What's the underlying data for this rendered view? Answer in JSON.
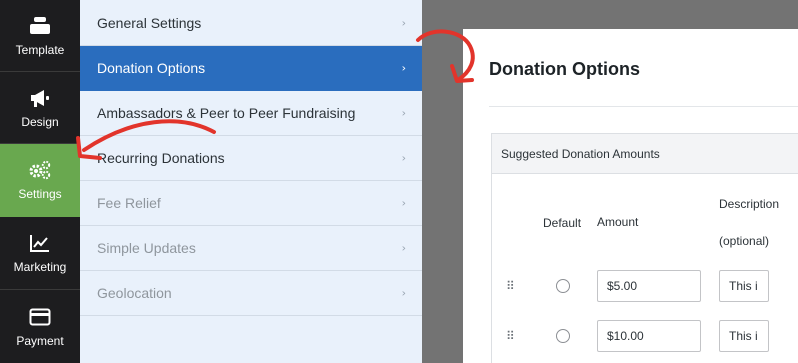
{
  "rail": {
    "items": [
      {
        "label": "Template",
        "icon": "template-icon"
      },
      {
        "label": "Design",
        "icon": "megaphone-icon"
      },
      {
        "label": "Settings",
        "icon": "gears-icon",
        "active": true
      },
      {
        "label": "Marketing",
        "icon": "chart-icon"
      },
      {
        "label": "Payment",
        "icon": "credit-card-icon"
      }
    ],
    "active_color": "#69a84f"
  },
  "menu": {
    "items": [
      {
        "label": "General Settings"
      },
      {
        "label": "Donation Options",
        "active": true
      },
      {
        "label": "Ambassadors & Peer to Peer Fundraising"
      },
      {
        "label": "Recurring Donations"
      },
      {
        "label": "Fee Relief",
        "muted": true
      },
      {
        "label": "Simple Updates",
        "muted": true
      },
      {
        "label": "Geolocation",
        "muted": true
      }
    ],
    "chevron": "›",
    "active_color": "#2a6dbe"
  },
  "panel": {
    "title": "Donation Options",
    "section_title": "Suggested Donation Amounts",
    "columns": {
      "default": "Default",
      "amount": "Amount",
      "description_line1": "Description",
      "description_line2": "(optional)"
    },
    "rows": [
      {
        "amount": "$5.00",
        "description": "This i"
      },
      {
        "amount": "$10.00",
        "description": "This i"
      }
    ],
    "handle_glyph": "⠿"
  },
  "annotation_color": "#e2342b"
}
